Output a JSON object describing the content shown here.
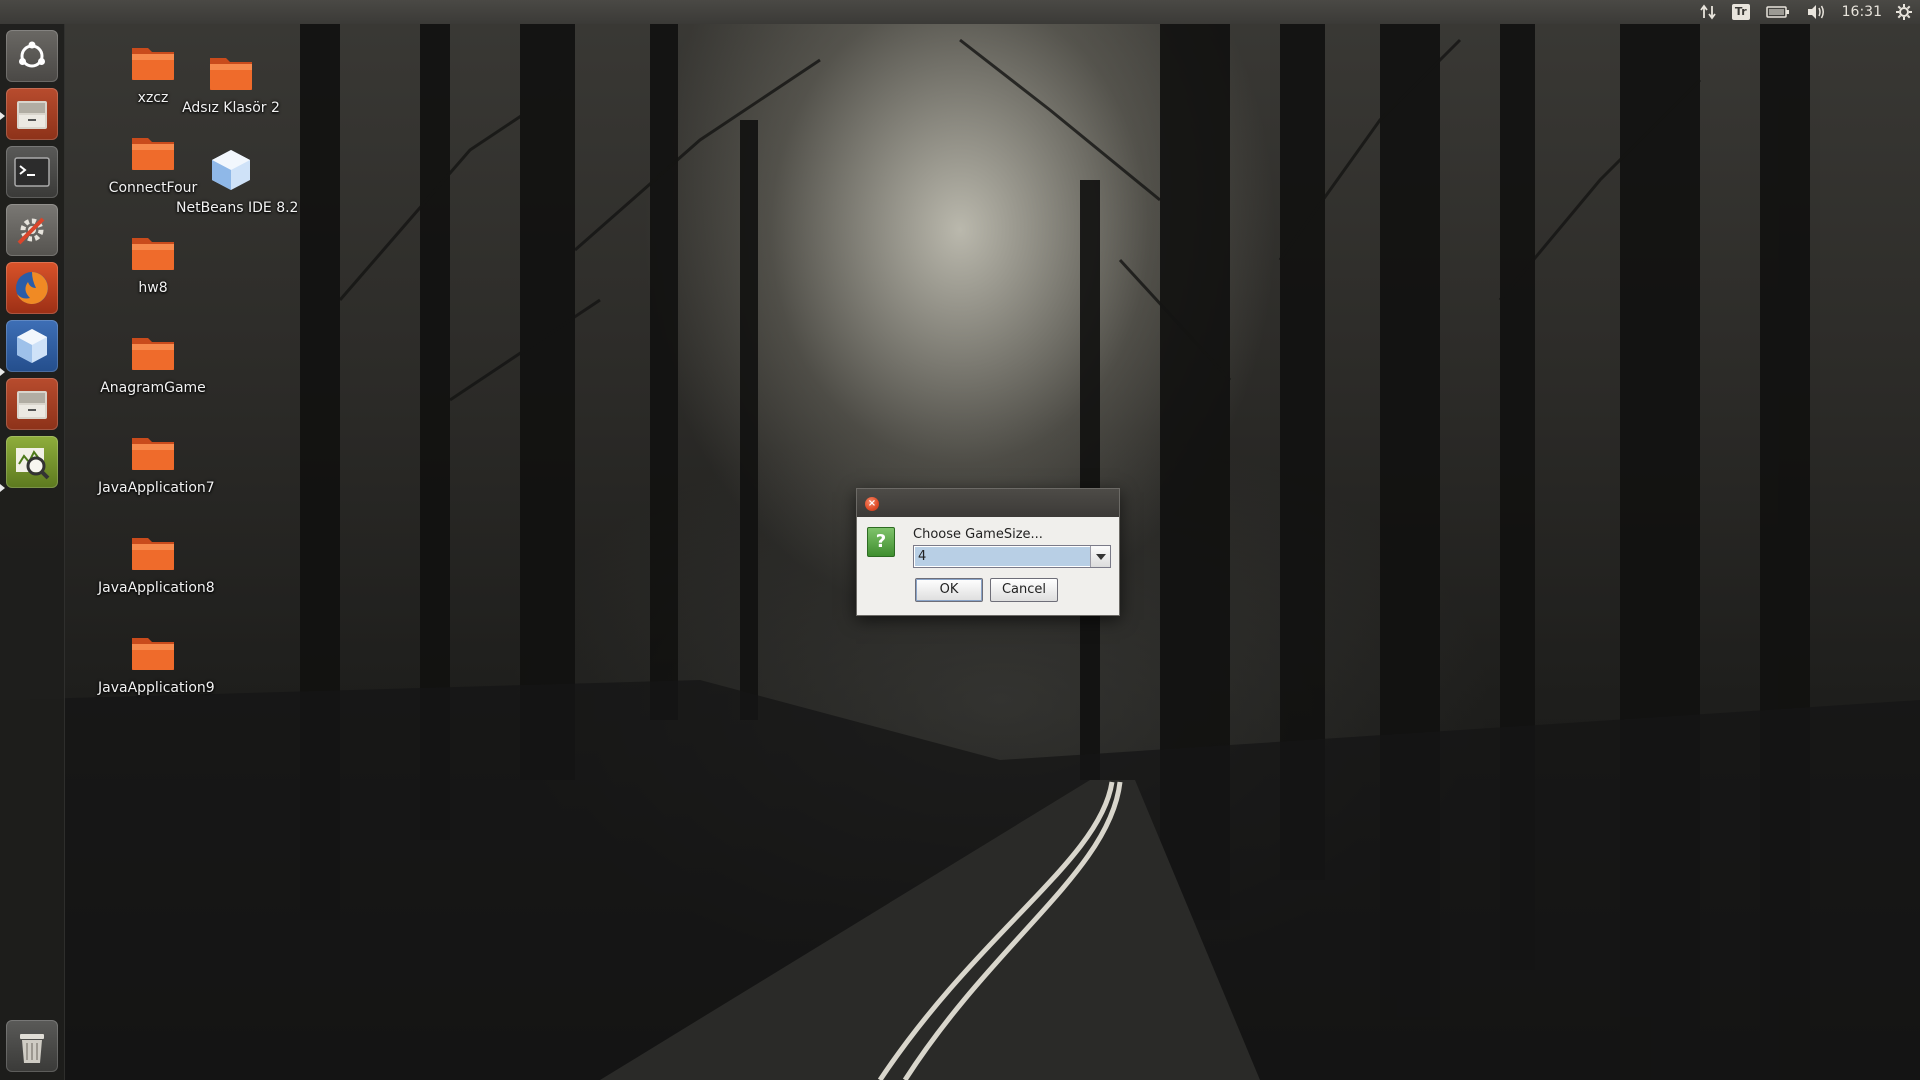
{
  "top_panel": {
    "keyboard_layout": "Tr",
    "clock": "16:31",
    "tray_icons": [
      "network-updown-icon",
      "keyboard-layout-icon",
      "battery-icon",
      "volume-icon",
      "session-gear-icon"
    ]
  },
  "launcher": {
    "items": [
      {
        "name": "ubuntu-dash",
        "icon": "ubuntu-logo-icon"
      },
      {
        "name": "files",
        "icon": "file-cabinet-icon"
      },
      {
        "name": "terminal",
        "icon": "terminal-icon"
      },
      {
        "name": "system-settings",
        "icon": "settings-tools-icon"
      },
      {
        "name": "firefox",
        "icon": "firefox-icon"
      },
      {
        "name": "netbeans",
        "icon": "netbeans-cube-icon"
      },
      {
        "name": "files-2",
        "icon": "file-cabinet-icon"
      },
      {
        "name": "system-monitor",
        "icon": "system-monitor-icon"
      },
      {
        "name": "trash",
        "icon": "trash-icon"
      }
    ]
  },
  "desktop": {
    "icons": [
      {
        "label": "xzcz",
        "type": "folder"
      },
      {
        "label": "Adsız Klasör 2",
        "type": "folder"
      },
      {
        "label": "ConnectFour",
        "type": "folder"
      },
      {
        "label": "NetBeans IDE 8.2",
        "type": "app"
      },
      {
        "label": "hw8",
        "type": "folder"
      },
      {
        "label": "AnagramGame",
        "type": "folder"
      },
      {
        "label": "JavaApplication7",
        "type": "folder"
      },
      {
        "label": "JavaApplication8",
        "type": "folder"
      },
      {
        "label": "JavaApplication9",
        "type": "folder"
      }
    ]
  },
  "dialog": {
    "prompt": "Choose GameSize...",
    "selected_value": "4",
    "ok_label": "OK",
    "cancel_label": "Cancel",
    "icon": "question-icon"
  },
  "colors": {
    "folder_orange": "#e8672a",
    "panel_bg": "#3b3a37",
    "dialog_bg": "#f0efec",
    "selection_blue": "#b8cfe5"
  }
}
